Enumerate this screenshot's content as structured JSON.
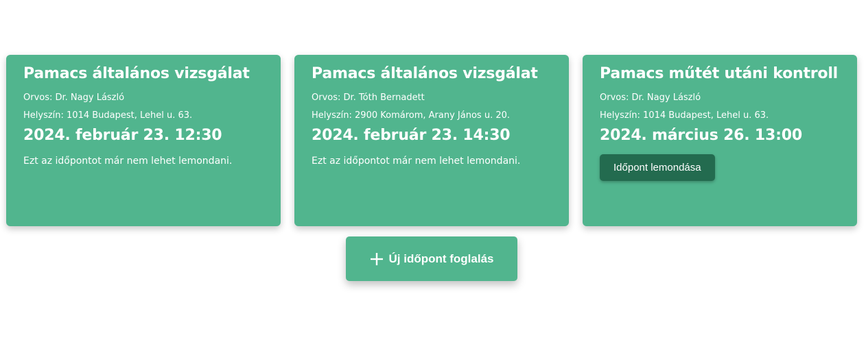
{
  "colors": {
    "card_bg": "#51b58e",
    "button_dark": "#236b4f",
    "text": "#ffffff"
  },
  "appointments": [
    {
      "title": "Pamacs általános vizsgálat",
      "doctor": "Orvos: Dr. Nagy László",
      "location": "Helyszín: 1014 Budapest, Lehel u. 63.",
      "datetime": "2024. február 23. 12:30",
      "note": "Ezt az időpontot már nem lehet lemondani."
    },
    {
      "title": "Pamacs általános vizsgálat",
      "doctor": "Orvos: Dr. Tóth Bernadett",
      "location": "Helyszín: 2900 Komárom, Arany János u. 20.",
      "datetime": "2024. február 23. 14:30",
      "note": "Ezt az időpontot már nem lehet lemondani."
    },
    {
      "title": "Pamacs műtét utáni kontroll",
      "doctor": "Orvos: Dr. Nagy László",
      "location": "Helyszín: 1014 Budapest, Lehel u. 63.",
      "datetime": "2024. március 26. 13:00",
      "cancel_label": "Időpont lemondása"
    }
  ],
  "new_booking": {
    "icon": "plus-icon",
    "label": "Új időpont foglalás"
  }
}
